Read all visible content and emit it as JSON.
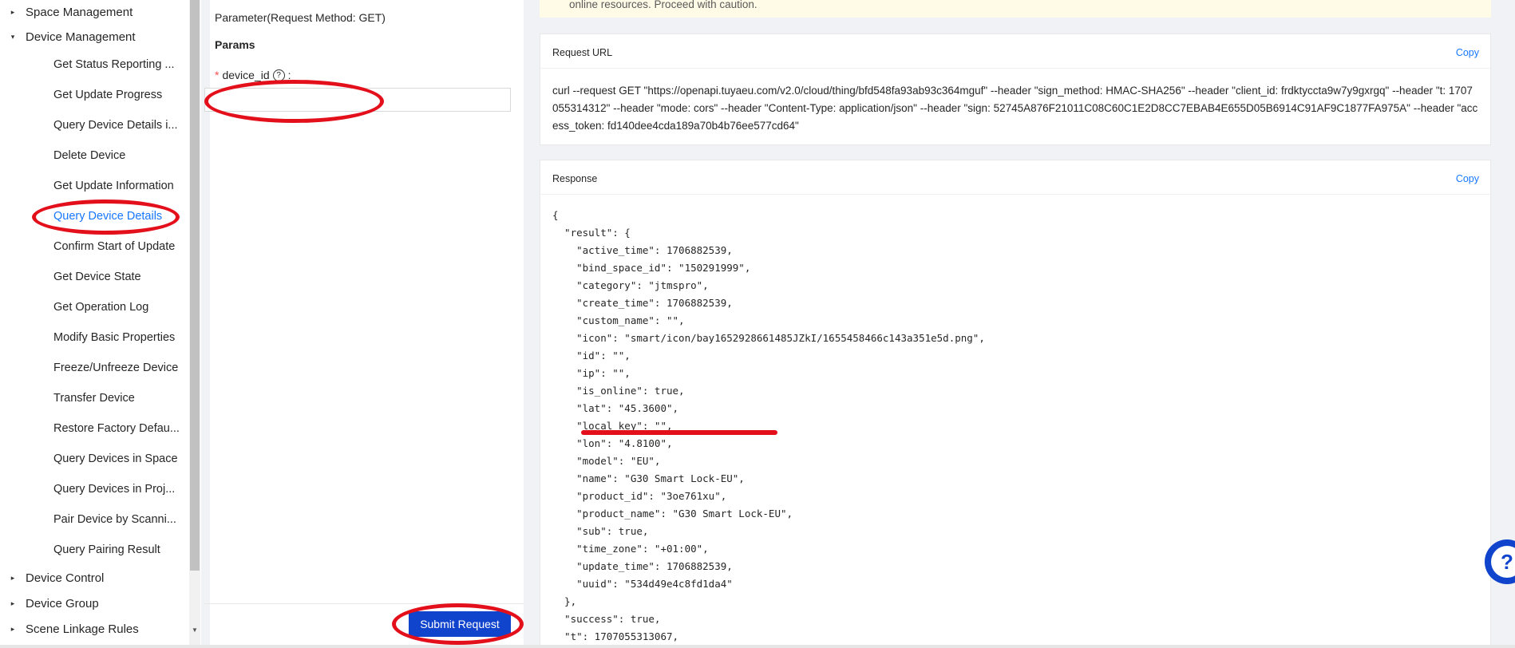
{
  "sidebar": {
    "groups": [
      {
        "label": "Space Management",
        "expanded": false
      },
      {
        "label": "Device Management",
        "expanded": true
      },
      {
        "label": "Device Control",
        "expanded": false
      },
      {
        "label": "Device Group",
        "expanded": false
      },
      {
        "label": "Scene Linkage Rules",
        "expanded": false
      }
    ],
    "items": [
      {
        "label": "Get Status Reporting ..."
      },
      {
        "label": "Get Update Progress"
      },
      {
        "label": "Query Device Details i..."
      },
      {
        "label": "Delete Device"
      },
      {
        "label": "Get Update Information"
      },
      {
        "label": "Query Device Details",
        "active": true
      },
      {
        "label": "Confirm Start of Update"
      },
      {
        "label": "Get Device State"
      },
      {
        "label": "Get Operation Log"
      },
      {
        "label": "Modify Basic Properties"
      },
      {
        "label": "Freeze/Unfreeze Device"
      },
      {
        "label": "Transfer Device"
      },
      {
        "label": "Restore Factory Defau..."
      },
      {
        "label": "Query Devices in Space"
      },
      {
        "label": "Query Devices in Proj..."
      },
      {
        "label": "Pair Device by Scanni..."
      },
      {
        "label": "Query Pairing Result"
      }
    ]
  },
  "params": {
    "title": "Parameter(Request Method: GET)",
    "section_label": "Params",
    "required_mark": "*",
    "device_id_label": "device_id",
    "colon": ":",
    "help_glyph": "?",
    "device_id_value": "",
    "submit_label": "Submit Request"
  },
  "warning": {
    "text": "online resources. Proceed with caution."
  },
  "request_url": {
    "title": "Request URL",
    "copy_label": "Copy",
    "text": "curl --request GET \"https://openapi.tuyaeu.com/v2.0/cloud/thing/bfd548fa93ab93c364mguf\" --header \"sign_method: HMAC-SHA256\" --header \"client_id: frdktyccta9w7y9gxrgq\" --header \"t: 1707055314312\" --header \"mode: cors\" --header \"Content-Type: application/json\" --header \"sign: 52745A876F21011C08C60C1E2D8CC7EBAB4E655D05B6914C91AF9C1877FA975A\" --header \"access_token: fd140dee4cda189a70b4b76ee577cd64\""
  },
  "response": {
    "title": "Response",
    "copy_label": "Copy",
    "lines": [
      "{",
      "  \"result\": {",
      "    \"active_time\": 1706882539,",
      "    \"bind_space_id\": \"150291999\",",
      "    \"category\": \"jtmspro\",",
      "    \"create_time\": 1706882539,",
      "    \"custom_name\": \"\",",
      "    \"icon\": \"smart/icon/bay1652928661485JZkI/1655458466c143a351e5d.png\",",
      "    \"id\": \"\",",
      "    \"ip\": \"\",",
      "    \"is_online\": true,",
      "    \"lat\": \"45.3600\",",
      "    \"local_key\": \"\",",
      "    \"lon\": \"4.8100\",",
      "    \"model\": \"EU\",",
      "    \"name\": \"G30 Smart Lock-EU\",",
      "    \"product_id\": \"3oe761xu\",",
      "    \"product_name\": \"G30 Smart Lock-EU\",",
      "    \"sub\": true,",
      "    \"time_zone\": \"+01:00\",",
      "    \"update_time\": 1706882539,",
      "    \"uuid\": \"534d49e4c8fd1da4\"",
      "  },",
      "  \"success\": true,",
      "  \"t\": 1707055313067,"
    ]
  },
  "help_fab": {
    "glyph": "?"
  },
  "icons": {
    "collapsed_arrow": "▸",
    "expanded_arrow": "▾",
    "scroll_down": "▼"
  },
  "colors": {
    "accent": "#1677ff",
    "submit": "#1144cc",
    "annotation": "#e3101c",
    "warning_bg": "#fffbe6"
  }
}
